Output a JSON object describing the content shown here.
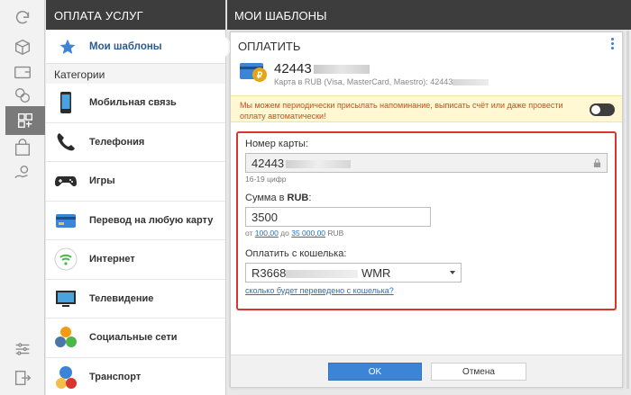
{
  "sidebar_header": "Оплата услуг",
  "favorites": {
    "label": "Мои шаблоны"
  },
  "categories_title": "Категории",
  "categories": [
    {
      "label": "Мобильная связь",
      "icon": "mobile-phone-icon"
    },
    {
      "label": "Телефония",
      "icon": "telephone-icon"
    },
    {
      "label": "Игры",
      "icon": "gamepad-icon"
    },
    {
      "label": "Перевод на любую карту",
      "icon": "bank-card-icon"
    },
    {
      "label": "Интернет",
      "icon": "wifi-icon"
    },
    {
      "label": "Телевидение",
      "icon": "tv-icon"
    },
    {
      "label": "Социальные сети",
      "icon": "social-networks-icon"
    },
    {
      "label": "Транспорт",
      "icon": "transport-icon"
    }
  ],
  "main_header": "Мои шаблоны",
  "payment": {
    "title": "Оплатить",
    "account_number": "42443",
    "account_desc": "Карта в RUB (Visa, MasterCard, Maestro): 42443"
  },
  "notice": "Мы можем периодически присылать напоминание, выписать счёт или даже провести оплату автоматически!",
  "form": {
    "card_label": "Номер карты:",
    "card_value": "42443",
    "card_hint": "16-19 цифр",
    "sum_label_prefix": "Сумма в ",
    "sum_currency": "RUB",
    "sum_label_suffix": ":",
    "sum_value": "3500",
    "sum_hint_from": "от ",
    "sum_min": "100,00",
    "sum_hint_to": " до ",
    "sum_max": "35 000,00",
    "sum_hint_cur": " RUB",
    "wallet_label": "Оплатить с кошелька:",
    "wallet_value": "R3668",
    "wallet_currency": "WMR",
    "calc_link": "сколько будет переведено с кошелька?"
  },
  "buttons": {
    "ok": "OK",
    "cancel": "Отмена"
  },
  "colors": {
    "header_bg": "#3d3d3d",
    "accent": "#3c84d6",
    "highlight": "#d9352f",
    "notice_bg": "#fff8d2"
  }
}
